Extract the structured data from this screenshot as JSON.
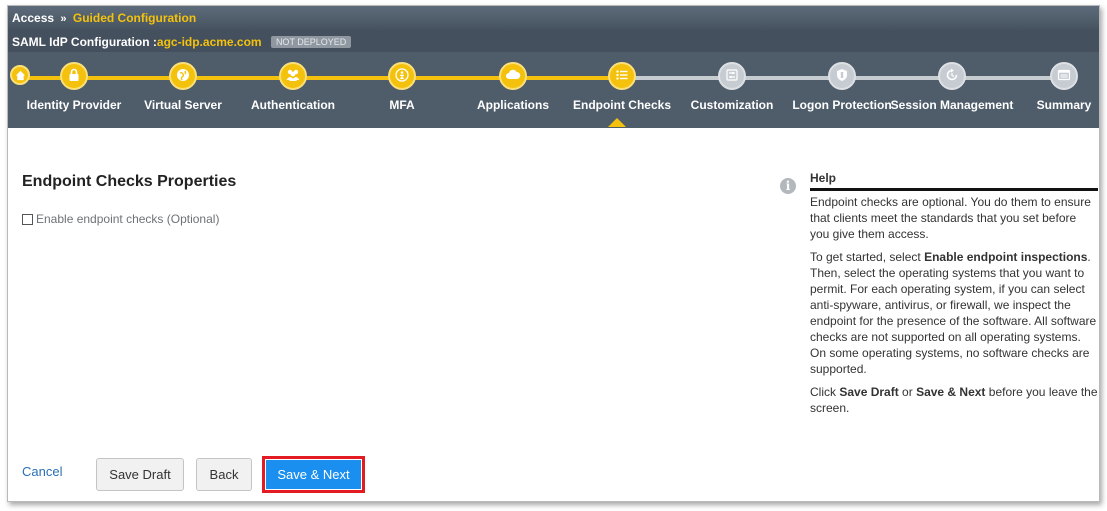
{
  "breadcrumb": {
    "root": "Access",
    "separator": "»",
    "current": "Guided Configuration"
  },
  "config": {
    "label": "SAML IdP Configuration :",
    "host": "agc-idp.acme.com",
    "status": "NOT DEPLOYED"
  },
  "wizard": {
    "steps": [
      {
        "label": "Identity Provider",
        "icon": "lock-icon",
        "state": "done"
      },
      {
        "label": "Virtual Server",
        "icon": "globe-icon",
        "state": "done"
      },
      {
        "label": "Authentication",
        "icon": "users-icon",
        "state": "done"
      },
      {
        "label": "MFA",
        "icon": "person-icon",
        "state": "done"
      },
      {
        "label": "Applications",
        "icon": "cloud-icon",
        "state": "done"
      },
      {
        "label": "Endpoint Checks",
        "icon": "list-icon",
        "state": "current"
      },
      {
        "label": "Customization",
        "icon": "sliders-icon",
        "state": "todo"
      },
      {
        "label": "Logon Protection",
        "icon": "shield-icon",
        "state": "todo"
      },
      {
        "label": "Session Management",
        "icon": "refresh-icon",
        "state": "todo"
      },
      {
        "label": "Summary",
        "icon": "window-icon",
        "state": "todo"
      }
    ]
  },
  "main": {
    "title": "Endpoint Checks Properties",
    "checkbox_label": "Enable endpoint checks (Optional)",
    "checkbox_checked": false
  },
  "help": {
    "heading": "Help",
    "p1": "Endpoint checks are optional. You do them to ensure that clients meet the standards that you set before you give them access.",
    "p2_pre": "To get started, select ",
    "p2_bold": "Enable endpoint inspections",
    "p2_post": ". Then, select the operating systems that you want to permit. For each operating system, if you can select anti-spyware, antivirus, or firewall, we inspect the endpoint for the presence of the software. All software checks are not supported on all operating systems. On some operating systems, no software checks are supported.",
    "p3_pre": "Click ",
    "p3_bold1": "Save Draft",
    "p3_mid": " or ",
    "p3_bold2": "Save & Next",
    "p3_post": " before you leave the screen."
  },
  "footer": {
    "cancel": "Cancel",
    "save_draft": "Save Draft",
    "back": "Back",
    "save_next": "Save & Next"
  },
  "colors": {
    "accent": "#f4c20d",
    "primary_button": "#1a8ff0",
    "highlight": "#e31b23"
  }
}
